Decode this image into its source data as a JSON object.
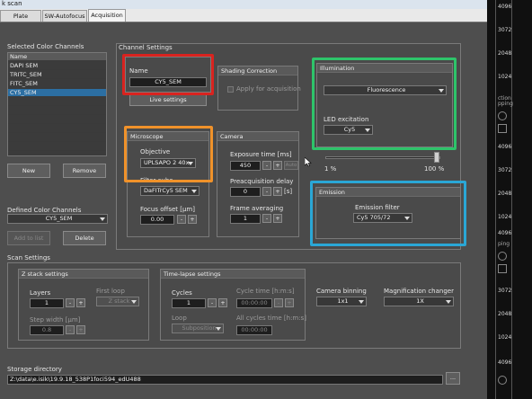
{
  "window": {
    "title": "k scan"
  },
  "tabs": [
    {
      "label": "Plate Manager"
    },
    {
      "label": "SW-Autofocus"
    },
    {
      "label": "Acquisition"
    }
  ],
  "selected_channels": {
    "title": "Selected Color Channels",
    "header": "Name",
    "items": [
      "DAPI SEM",
      "TRITC_SEM",
      "FITC_SEM",
      "CY5_SEM"
    ],
    "selected_index": 3
  },
  "buttons": {
    "new": "New",
    "remove": "Remove",
    "add_to_list": "Add to list",
    "delete": "Delete",
    "live_settings": "Live settings",
    "browse": "...",
    "apply_for_acquisition": "Apply for acquisition"
  },
  "defined_channels": {
    "title": "Defined Color Channels",
    "value": "CY5_SEM"
  },
  "channel_settings": {
    "title": "Channel Settings",
    "name_group": "Name",
    "name_value": "CY5_SEM",
    "shading_group": "Shading Correction",
    "illumination_group": "Illumination",
    "illumination_value": "Fluorescence",
    "led_label": "LED excitation",
    "led_value": "Cy5",
    "slider_min": "1 %",
    "slider_max": "100 %",
    "slider_fraction": 0.97,
    "microscope_group": "Microscope",
    "objective_label": "Objective",
    "objective_value": "UPLSAPO 2 40x",
    "filter_cube_label": "Filter cube",
    "filter_cube_value": "DaFITrCy5 SEM",
    "focus_offset_label": "Focus offset [µm]",
    "focus_offset_value": "0.00",
    "camera_group": "Camera",
    "exposure_label": "Exposure time [ms]",
    "exposure_value": "450",
    "auto_label": "Auto",
    "preacq_label": "Preacquisition delay",
    "preacq_value": "0",
    "preacq_unit": "[s]",
    "frame_avg_label": "Frame averaging",
    "frame_avg_value": "1",
    "emission_group": "Emission",
    "emission_filter_label": "Emission filter",
    "emission_filter_value": "Cy5 705/72"
  },
  "scan_settings": {
    "title": "Scan Settings",
    "zstack_group": "Z stack settings",
    "layers_label": "Layers",
    "layers_value": "1",
    "first_loop_label": "First loop",
    "first_loop_value": "Z stack",
    "step_width_label": "Step width [µm]",
    "step_width_value": "0.8",
    "timelapse_group": "Time-lapse settings",
    "cycles_label": "Cycles",
    "cycles_value": "1",
    "cycle_time_label": "Cycle time [h:m:s]",
    "cycle_time_value": "00:00:00",
    "loop_label": "Loop",
    "loop_value": "Subposition",
    "all_cycles_label": "All cycles time [h:m:s]",
    "all_cycles_value": "00:00:00",
    "binning_label": "Camera binning",
    "binning_value": "1x1",
    "mag_label": "Magnification changer",
    "mag_value": "1X"
  },
  "storage": {
    "label": "Storage directory",
    "path": "Z:\\data\\e.isik\\19.9.18_538P1foci594_edU488"
  },
  "right_panel": {
    "numbers": [
      "4096",
      "3072",
      "2048",
      "1024",
      "4096",
      "3072",
      "2048",
      "1024",
      "4096",
      "3072",
      "2048",
      "1024",
      "4096"
    ],
    "labels": [
      "ction",
      "pping",
      "ping"
    ]
  },
  "spin": {
    "minus": "-",
    "plus": "+"
  },
  "highlights": {
    "name": "#d9231f",
    "microscope": "#f0922a",
    "illumination": "#2ec46a",
    "emission": "#2aa7d6"
  }
}
